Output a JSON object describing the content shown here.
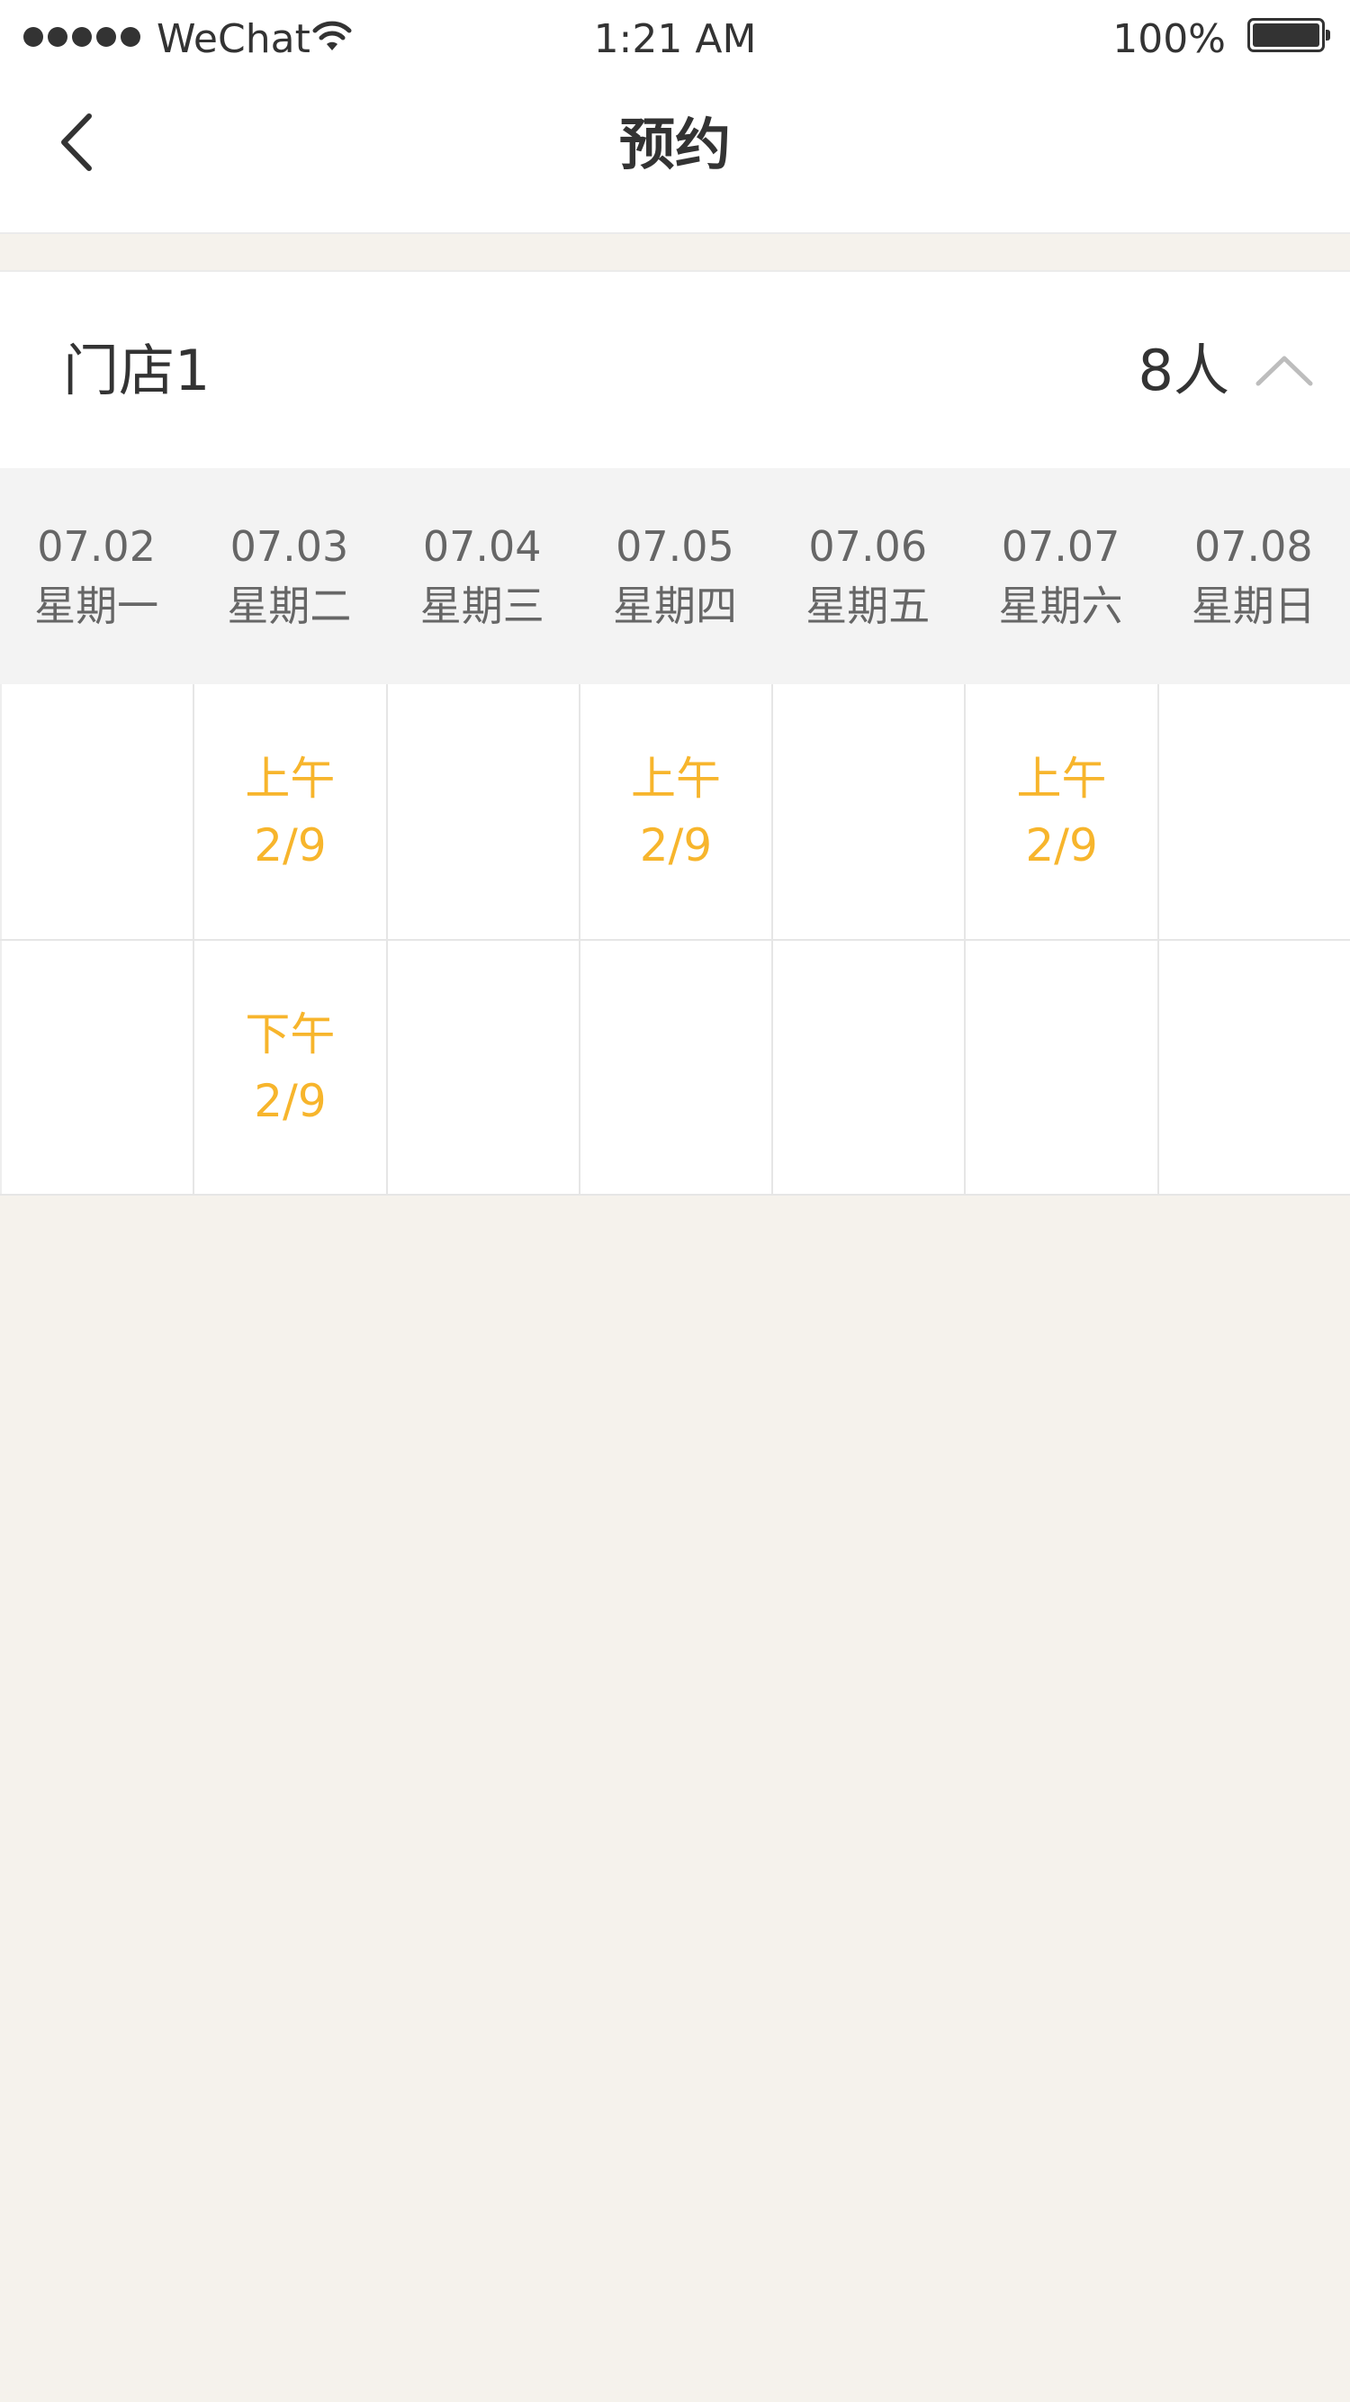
{
  "status_bar": {
    "carrier": "WeChat",
    "time": "1:21 AM",
    "battery_percent": "100%",
    "battery_level": 1.0
  },
  "nav": {
    "title": "预约",
    "back_icon": "chevron-left-icon"
  },
  "store": {
    "name": "门店1",
    "count": "8人",
    "toggle_icon": "chevron-up-icon"
  },
  "days": [
    {
      "date": "07.02",
      "weekday": "星期一"
    },
    {
      "date": "07.03",
      "weekday": "星期二"
    },
    {
      "date": "07.04",
      "weekday": "星期三"
    },
    {
      "date": "07.05",
      "weekday": "星期四"
    },
    {
      "date": "07.06",
      "weekday": "星期五"
    },
    {
      "date": "07.07",
      "weekday": "星期六"
    },
    {
      "date": "07.08",
      "weekday": "星期日"
    }
  ],
  "slots": {
    "morning": [
      {
        "period": "",
        "count": ""
      },
      {
        "period": "上午",
        "count": "2/9"
      },
      {
        "period": "",
        "count": ""
      },
      {
        "period": "上午",
        "count": "2/9"
      },
      {
        "period": "",
        "count": ""
      },
      {
        "period": "上午",
        "count": "2/9"
      },
      {
        "period": "",
        "count": ""
      }
    ],
    "afternoon": [
      {
        "period": "",
        "count": ""
      },
      {
        "period": "下午",
        "count": "2/9"
      },
      {
        "period": "",
        "count": ""
      },
      {
        "period": "",
        "count": ""
      },
      {
        "period": "",
        "count": ""
      },
      {
        "period": "",
        "count": ""
      },
      {
        "period": "",
        "count": ""
      }
    ]
  },
  "colors": {
    "accent": "#f7b52c",
    "background": "#f5f2ec",
    "header_row": "#f3f3f3"
  }
}
